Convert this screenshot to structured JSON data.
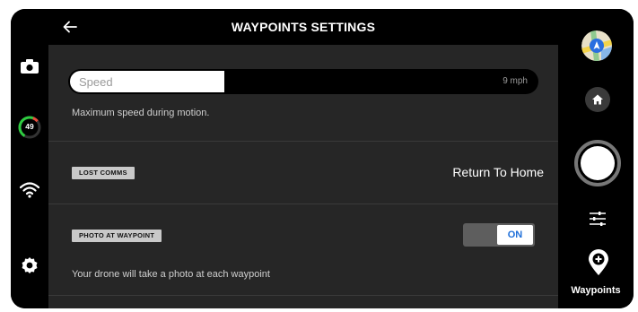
{
  "header": {
    "title": "WAYPOINTS SETTINGS"
  },
  "left_rail": {
    "icons": [
      "camera-icon",
      "battery-ring-icon",
      "wifi-icon",
      "gear-icon"
    ],
    "battery_value": "49"
  },
  "speed": {
    "label": "Speed",
    "value_text": "9 mph",
    "fill_fraction": 0.33,
    "description": "Maximum speed during motion."
  },
  "lost_comms": {
    "badge": "LOST COMMS",
    "value": "Return To Home"
  },
  "photo_at_waypoint": {
    "badge": "PHOTO AT WAYPOINT",
    "toggle_label": "ON",
    "enabled": true,
    "description": "Your drone will take a photo at each waypoint"
  },
  "right_rail": {
    "icons": [
      "map-icon",
      "home-icon",
      "shutter-button",
      "sliders-icon",
      "waypoint-add-icon"
    ],
    "waypoints_label": "Waypoints"
  },
  "colors": {
    "panel": "#262626",
    "background": "#000000",
    "accent": "#1e6fd9",
    "battery_ring": "#2ecc40"
  }
}
